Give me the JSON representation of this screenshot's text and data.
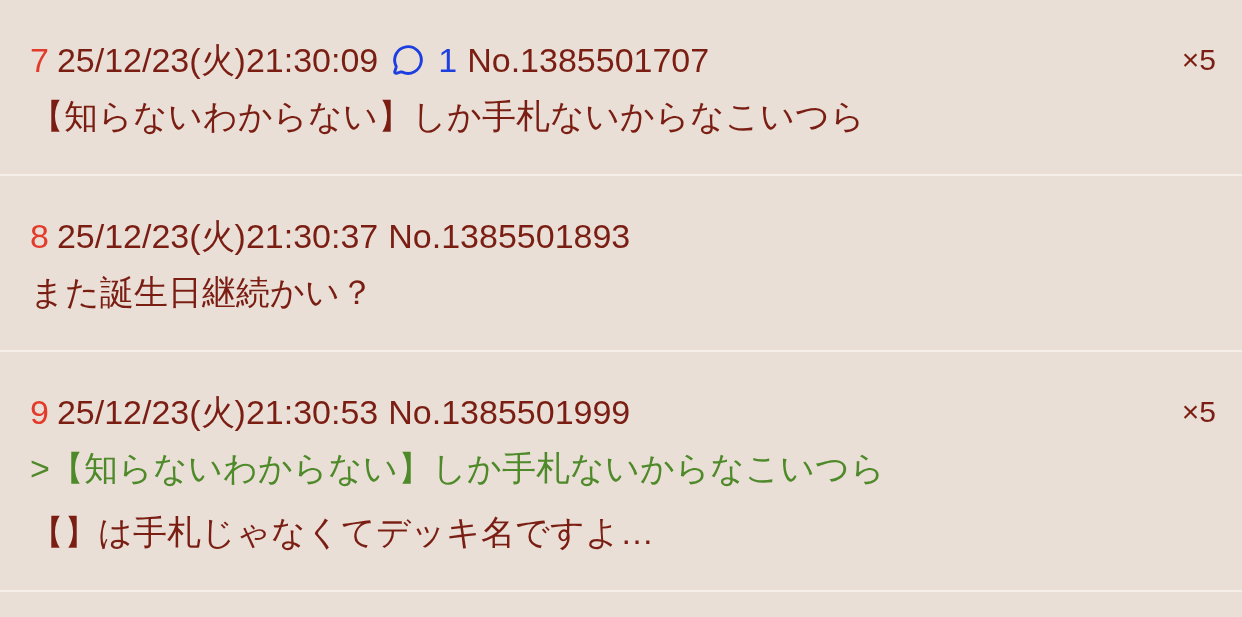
{
  "posts": [
    {
      "number": "7",
      "datetime": "25/12/23(火)21:30:09",
      "replies": "1",
      "post_no": "No.1385501707",
      "count": "×5",
      "lines": [
        {
          "kind": "text",
          "text": "【知らないわからない】しか手札ないからなこいつら"
        }
      ]
    },
    {
      "number": "8",
      "datetime": "25/12/23(火)21:30:37",
      "post_no": "No.1385501893",
      "lines": [
        {
          "kind": "text",
          "text": "また誕生日継続かい？"
        }
      ]
    },
    {
      "number": "9",
      "datetime": "25/12/23(火)21:30:53",
      "post_no": "No.1385501999",
      "count": "×5",
      "lines": [
        {
          "kind": "quote",
          "text": ">【知らないわからない】しか手札ないからなこいつら"
        },
        {
          "kind": "text",
          "text": "【】は手札じゃなくてデッキ名ですよ…"
        }
      ]
    }
  ]
}
